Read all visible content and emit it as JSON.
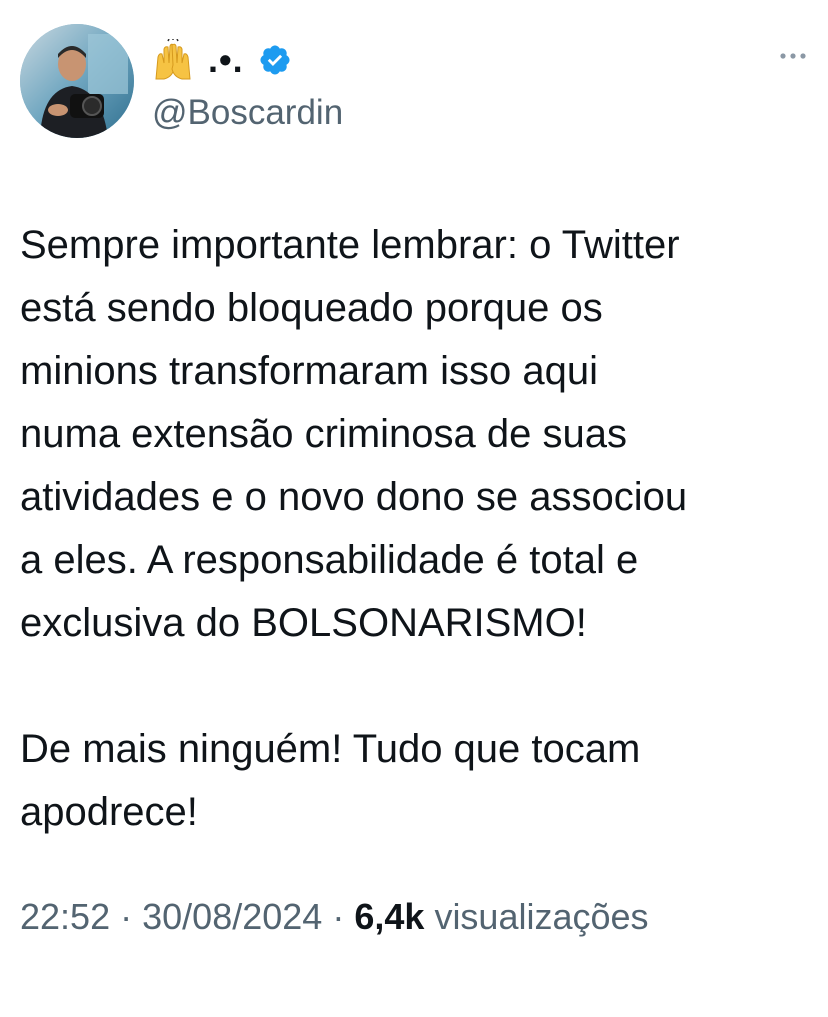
{
  "author": {
    "display_name": ".•.",
    "emoji": "raised-hands-icon",
    "verified_icon": "verified-badge-icon",
    "handle": "@Boscardin"
  },
  "tweet": {
    "paragraphs": [
      "Sempre importante lembrar: o Twitter\nestá sendo bloqueado porque os\nminions transformaram isso aqui\nnuma extensão criminosa de suas\natividades e o novo dono se associou\na eles. A responsabilidade é total e\nexclusiva do BOLSONARISMO!",
      "De mais ninguém! Tudo que tocam\napodrece!"
    ]
  },
  "meta": {
    "time": "22:52",
    "separator": "·",
    "date": "30/08/2024",
    "views_count": "6,4k",
    "views_label": "visualizações"
  },
  "colors": {
    "verified": "#1d9bf0",
    "text": "#0f1419",
    "secondary": "#536471"
  },
  "more_icon": "more-options-icon"
}
